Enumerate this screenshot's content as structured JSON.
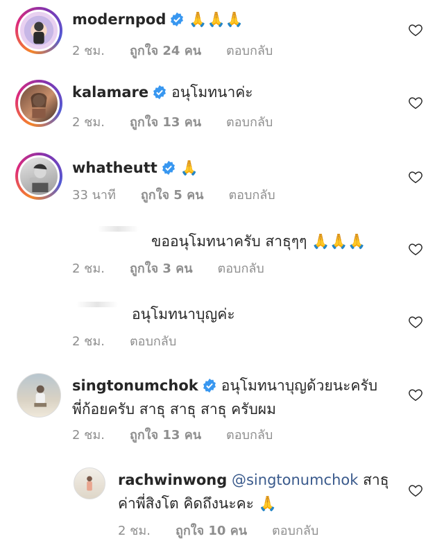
{
  "comments": [
    {
      "username": "modernpod",
      "verified": true,
      "text": "",
      "emoji": "🙏🙏🙏",
      "time": "2 ชม.",
      "likes_label": "ถูกใจ 24 คน",
      "reply": "ตอบกลับ"
    },
    {
      "username": "kalamare",
      "verified": true,
      "text": "อนุโมทนาค่ะ",
      "time": "2 ชม.",
      "likes_label": "ถูกใจ 13 คน",
      "reply": "ตอบกลับ"
    },
    {
      "username": "whatheutt",
      "verified": true,
      "text": "",
      "emoji": "🙏",
      "time": "33 นาที",
      "likes_label": "ถูกใจ 5 คน",
      "reply": "ตอบกลับ"
    },
    {
      "username": "",
      "verified": false,
      "text": "ขออนุโมทนาครับ สาธุๆๆ",
      "emoji": "🙏🙏🙏",
      "time": "2 ชม.",
      "likes_label": "ถูกใจ 3 คน",
      "reply": "ตอบกลับ"
    },
    {
      "username": "",
      "verified": false,
      "text": "อนุโมทนาบุญค่ะ",
      "time": "2 ชม.",
      "reply": "ตอบกลับ"
    },
    {
      "username": "singtonumchok",
      "verified": true,
      "text": "อนุโมทนาบุญด้วยนะครับ",
      "text2": "พี่ก้อยครับ สาธุ สาธุ สาธุ ครับผม",
      "time": "2 ชม.",
      "likes_label": "ถูกใจ 13 คน",
      "reply": "ตอบกลับ"
    },
    {
      "username": "rachwinwong",
      "verified": false,
      "mention": "@singtonumchok",
      "text": "สาธุ",
      "text2": "ค่าพี่สิงโต คิดถึงนะคะ",
      "emoji": "🙏",
      "time": "2 ชม.",
      "likes_label": "ถูกใจ 10 คน",
      "reply": "ตอบกลับ"
    }
  ],
  "colors": {
    "verified": "#3897f0",
    "meta": "#8e8e8e",
    "mention": "#3a5a8c"
  }
}
